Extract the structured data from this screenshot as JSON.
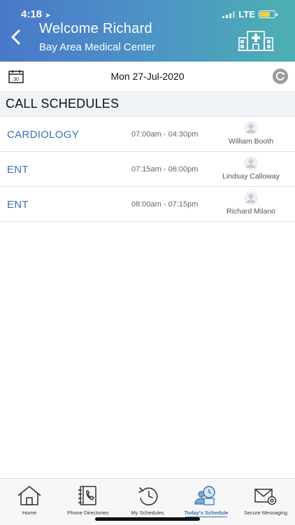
{
  "status": {
    "time": "4:18",
    "network": "LTE"
  },
  "header": {
    "title": "Welcome Richard",
    "subtitle": "Bay Area Medical Center"
  },
  "datebar": {
    "calendar_day": "30",
    "date": "Mon 27-Jul-2020"
  },
  "section": {
    "title": "CALL SCHEDULES"
  },
  "schedules": [
    {
      "department": "CARDIOLOGY",
      "time": "07:00am - 04:30pm",
      "person": "William Booth"
    },
    {
      "department": "ENT",
      "time": "07:15am - 06:00pm",
      "person": "Lindsay Calloway"
    },
    {
      "department": "ENT",
      "time": "08:00am - 07:15pm",
      "person": "Richard Milano"
    }
  ],
  "tabs": [
    {
      "label": "Home",
      "icon": "home-icon"
    },
    {
      "label": "Phone Directories",
      "icon": "phone-directory-icon"
    },
    {
      "label": "My Schedules",
      "icon": "history-clock-icon"
    },
    {
      "label": "Today's Schedule",
      "icon": "todays-schedule-icon",
      "active": true
    },
    {
      "label": "Secure Messaging",
      "icon": "secure-message-icon"
    }
  ],
  "colors": {
    "header_start": "#4a78c9",
    "header_end": "#4db0b2",
    "accent": "#3c6fb0",
    "battery": "#f4d03f"
  }
}
